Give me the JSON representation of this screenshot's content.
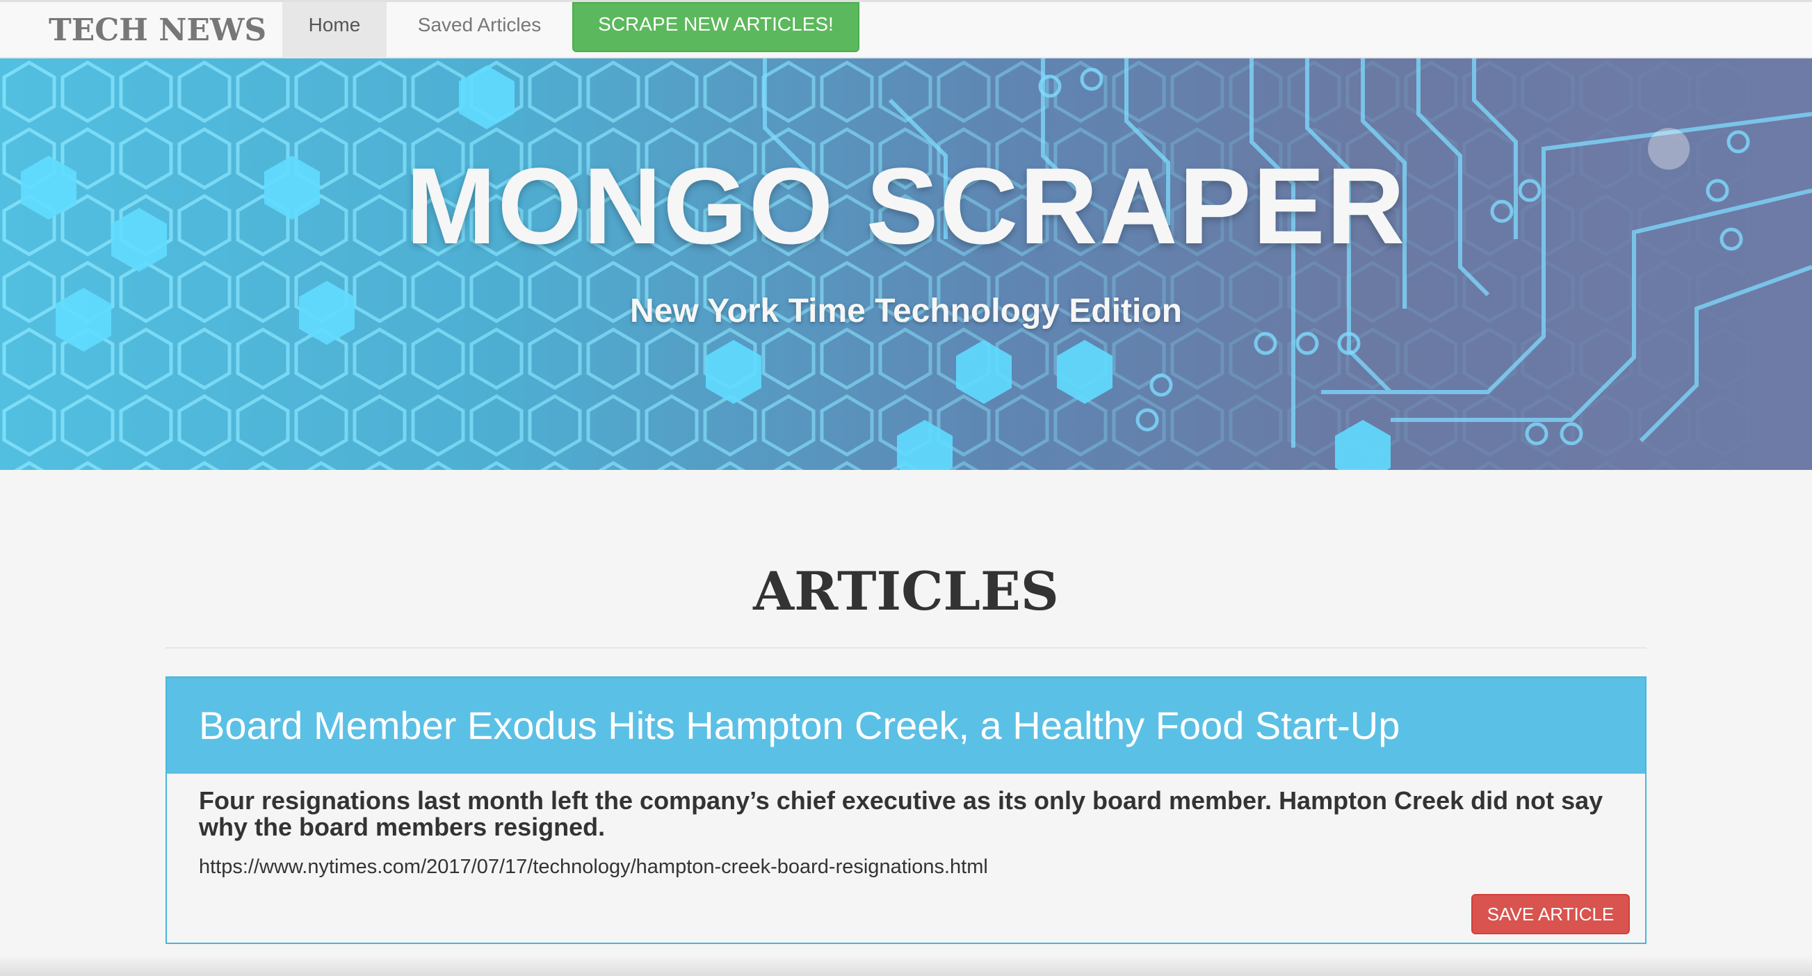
{
  "navbar": {
    "brand": "TECH NEWS",
    "items": [
      {
        "label": "Home",
        "active": true
      },
      {
        "label": "Saved Articles",
        "active": false
      }
    ],
    "scrape_button": "SCRAPE NEW ARTICLES!"
  },
  "hero": {
    "title": "MONGO SCRAPER",
    "subtitle": "New York Time Technology Edition"
  },
  "main": {
    "section_title": "ARTICLES",
    "articles": [
      {
        "title": "Board Member Exodus Hits Hampton Creek, a Healthy Food Start-Up",
        "summary": "Four resignations last month left the company’s chief executive as its only board member. Hampton Creek did not say why the board members resigned.",
        "link": "https://www.nytimes.com/2017/07/17/technology/hampton-creek-board-resignations.html",
        "save_label": "SAVE ARTICLE"
      }
    ]
  },
  "colors": {
    "scrape_button": "#5cb85c",
    "panel_heading": "#5bc0e5",
    "save_button": "#d9534f"
  }
}
